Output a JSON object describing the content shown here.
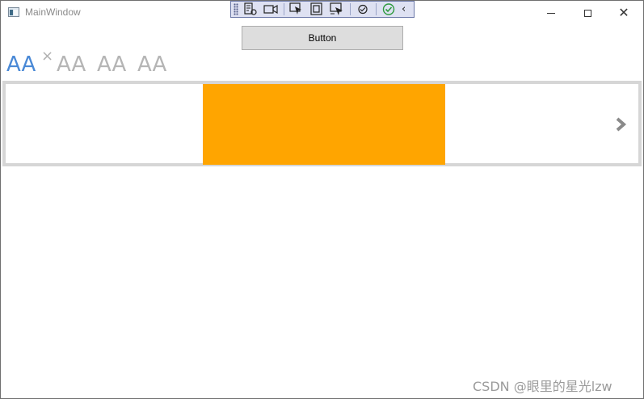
{
  "window": {
    "title": "MainWindow",
    "controls": {
      "minimize": "minimize",
      "maximize": "maximize",
      "close": "close"
    }
  },
  "debug_toolbar": {
    "icons": [
      "live-visual-tree-icon",
      "camera-icon",
      "select-element-icon",
      "display-layout-adorners-icon",
      "track-focus-icon",
      "binding-failures-icon",
      "hot-reload-check-icon",
      "collapse-chevron-icon"
    ]
  },
  "main_button": {
    "label": "Button"
  },
  "tabs": [
    {
      "label": "AA",
      "active": true,
      "closable": true
    },
    {
      "label": "AA",
      "active": false
    },
    {
      "label": "AA",
      "active": false
    },
    {
      "label": "AA",
      "active": false
    }
  ],
  "tab_close_glyph": "×",
  "carousel": {
    "slide_color": "#ffa500",
    "border_color": "#d6d6d6",
    "next_arrow": "chevron-right-icon"
  },
  "watermark": "CSDN @眼里的星光lzw",
  "colors": {
    "tab_active": "#4a89d6",
    "tab_inactive": "#b5b5b5"
  }
}
